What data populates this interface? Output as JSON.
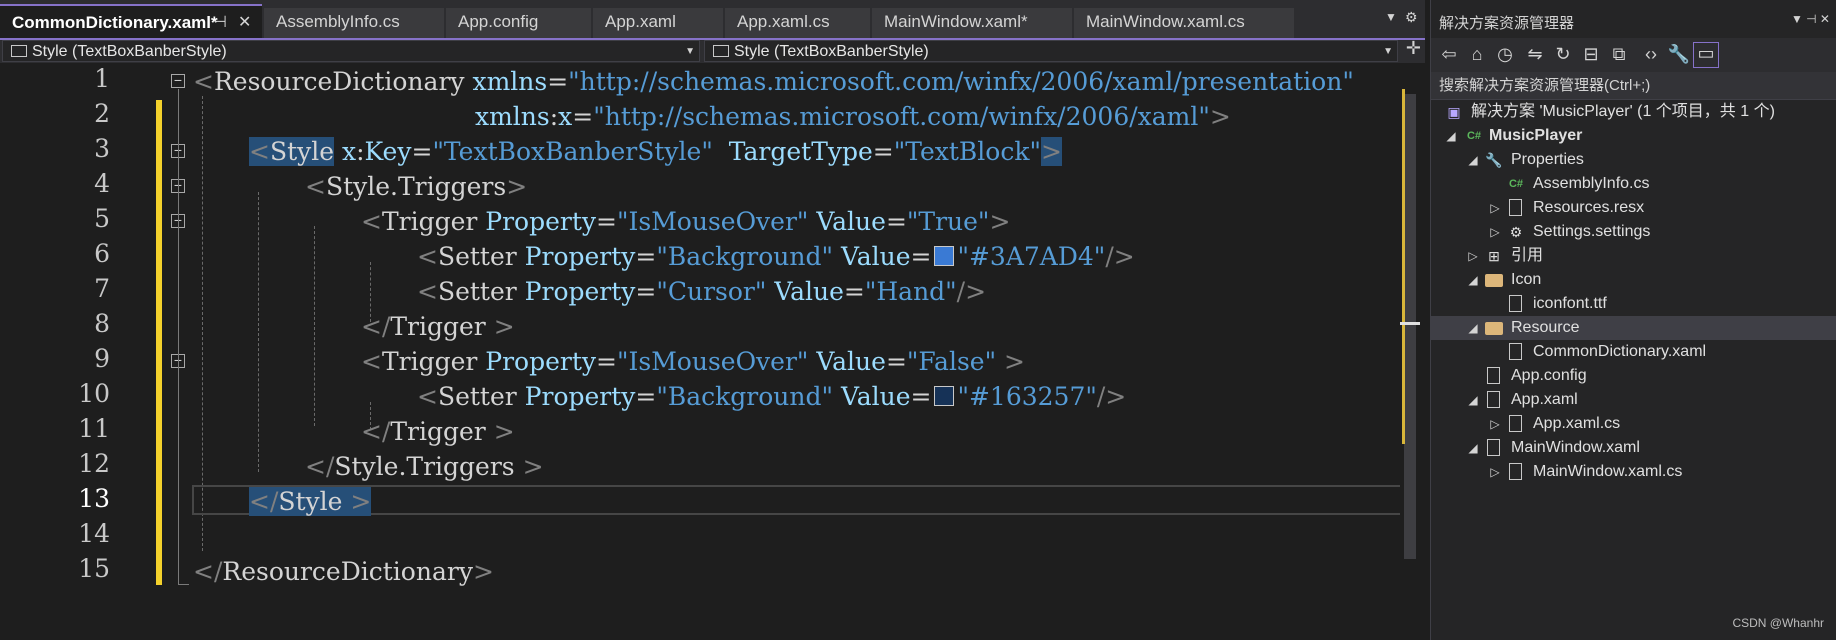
{
  "tabs": [
    {
      "label": "CommonDictionary.xaml*",
      "active": true
    },
    {
      "label": "AssemblyInfo.cs",
      "active": false
    },
    {
      "label": "App.config",
      "active": false
    },
    {
      "label": "App.xaml",
      "active": false
    },
    {
      "label": "App.xaml.cs",
      "active": false
    },
    {
      "label": "MainWindow.xaml*",
      "active": false
    },
    {
      "label": "MainWindow.xaml.cs",
      "active": false
    }
  ],
  "nav": {
    "left": "Style (TextBoxBanberStyle)",
    "right": "Style (TextBoxBanberStyle)"
  },
  "line_numbers": [
    "1",
    "2",
    "3",
    "4",
    "5",
    "6",
    "7",
    "8",
    "9",
    "10",
    "11",
    "12",
    "13",
    "14",
    "15"
  ],
  "current_line": "13",
  "code": {
    "l1": {
      "open": "<",
      "name": "ResourceDictionary",
      "attr1": "xmlns",
      "eq": "=",
      "val1": "\"http://schemas.microsoft.com/winfx/2006/xaml/presentation\""
    },
    "l2": {
      "attr": "xmlns",
      "colon": ":",
      "attr2": "x",
      "eq": "=",
      "val": "\"http://schemas.microsoft.com/winfx/2006/xaml\"",
      "close": ">"
    },
    "l3": {
      "open": "<",
      "name": "Style",
      "attr1": "x",
      "colon": ":",
      "attr1b": "Key",
      "val1": "\"TextBoxBanberStyle\"",
      "attr2": "TargetType",
      "val2": "\"TextBlock\"",
      "close": ">"
    },
    "l4": {
      "open": "<",
      "name": "Style.Triggers",
      "close": ">"
    },
    "l5": {
      "open": "<",
      "name": "Trigger",
      "attr1": "Property",
      "val1": "\"IsMouseOver\"",
      "attr2": "Value",
      "val2": "\"True\"",
      "close": ">"
    },
    "l6": {
      "open": "<",
      "name": "Setter",
      "attr1": "Property",
      "val1": "\"Background\"",
      "attr2": "Value",
      "color": "#3A7AD4",
      "val2": "\"#3A7AD4\"",
      "close": "/>"
    },
    "l7": {
      "open": "<",
      "name": "Setter",
      "attr1": "Property",
      "val1": "\"Cursor\"",
      "attr2": "Value",
      "val2": "\"Hand\"",
      "close": "/>"
    },
    "l8": {
      "open": "</",
      "name": "Trigger",
      "close": " >"
    },
    "l9": {
      "open": "<",
      "name": "Trigger",
      "attr1": "Property",
      "val1": "\"IsMouseOver\"",
      "attr2": "Value",
      "val2": "\"False\"",
      "close": " >"
    },
    "l10": {
      "open": "<",
      "name": "Setter",
      "attr1": "Property",
      "val1": "\"Background\"",
      "attr2": "Value",
      "color": "#163257",
      "val2": "\"#163257\"",
      "close": "/>"
    },
    "l11": {
      "open": "</",
      "name": "Trigger",
      "close": " >"
    },
    "l12": {
      "open": "</",
      "name": "Style.Triggers",
      "close": " >"
    },
    "l13": {
      "open": "</",
      "name": "Style",
      "close": " >"
    },
    "l15": {
      "open": "</",
      "name": "ResourceDictionary",
      "close": ">"
    }
  },
  "solution_explorer": {
    "title": "解决方案资源管理器",
    "search_placeholder": "搜索解决方案资源管理器(Ctrl+;)",
    "items": [
      {
        "label": "解决方案 'MusicPlayer' (1 个项目，共 1 个)",
        "icon": "solution-icon"
      },
      {
        "label": "MusicPlayer",
        "icon": "csharp-project-icon",
        "bold": true
      },
      {
        "label": "Properties",
        "icon": "wrench-icon"
      },
      {
        "label": "AssemblyInfo.cs",
        "icon": "csharp-file-icon"
      },
      {
        "label": "Resources.resx",
        "icon": "resx-file-icon"
      },
      {
        "label": "Settings.settings",
        "icon": "settings-gear-icon"
      },
      {
        "label": "引用",
        "icon": "references-icon"
      },
      {
        "label": "Icon",
        "icon": "folder-icon"
      },
      {
        "label": "iconfont.ttf",
        "icon": "font-file-icon"
      },
      {
        "label": "Resource",
        "icon": "folder-open-icon",
        "selected": true
      },
      {
        "label": "CommonDictionary.xaml",
        "icon": "xaml-file-icon"
      },
      {
        "label": "App.config",
        "icon": "config-file-icon"
      },
      {
        "label": "App.xaml",
        "icon": "xaml-file-icon"
      },
      {
        "label": "App.xaml.cs",
        "icon": "csharp-file-icon"
      },
      {
        "label": "MainWindow.xaml",
        "icon": "xaml-file-icon"
      },
      {
        "label": "MainWindow.xaml.cs",
        "icon": "csharp-file-icon"
      }
    ]
  },
  "watermark": "CSDN @Whanhr",
  "colors": {
    "accent": "#8672c9",
    "keyword": "#569cd6",
    "attribute": "#9cdcfe",
    "change_bar": "#f4d22c",
    "selection": "#264f78"
  }
}
